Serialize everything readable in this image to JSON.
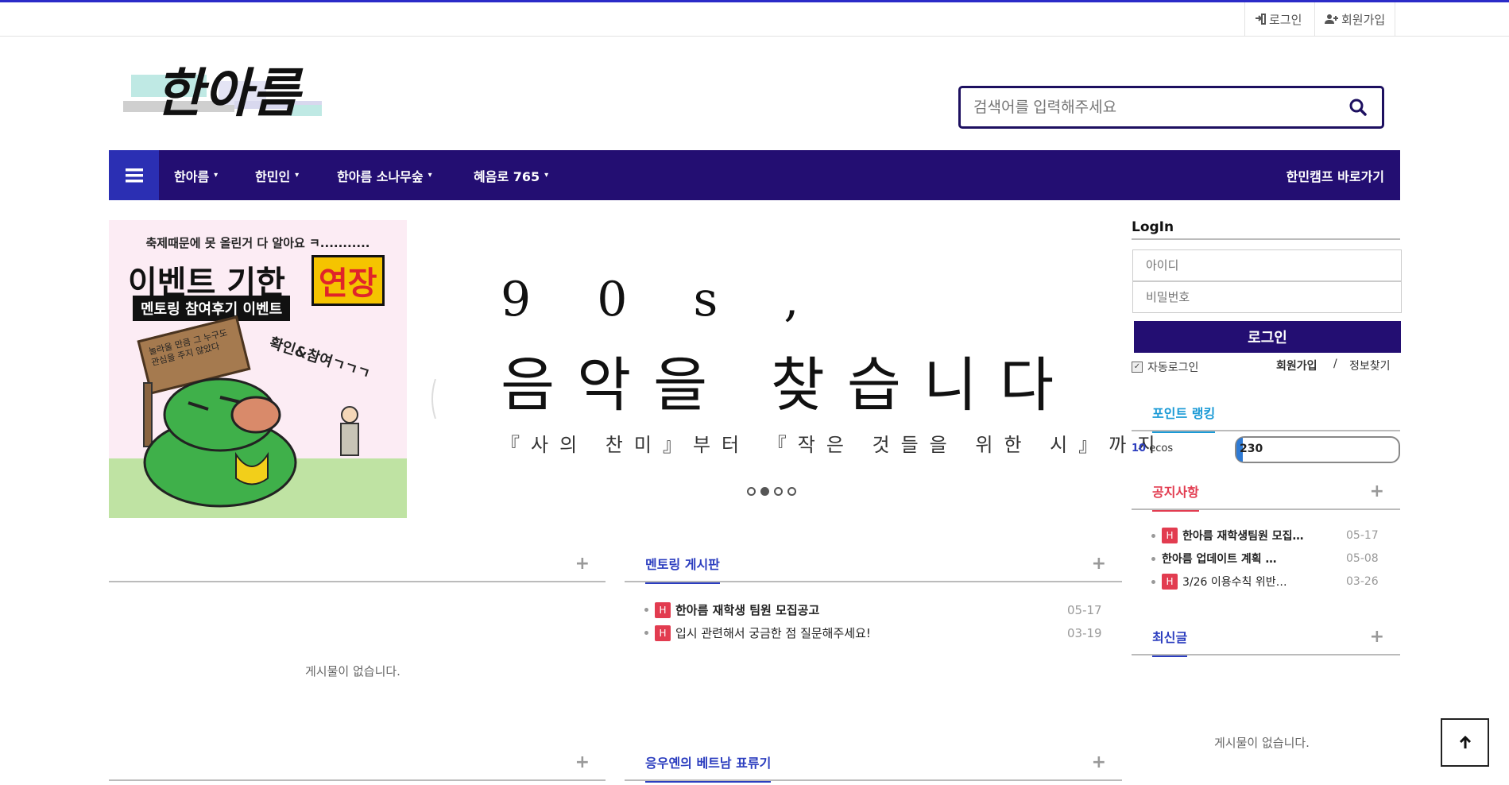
{
  "topbar": {
    "login": "로그인",
    "signup": "회원가입"
  },
  "search": {
    "placeholder": "검색어를 입력해주세요"
  },
  "logo": {
    "text": "한아름"
  },
  "nav": {
    "items": [
      {
        "label": "한아름"
      },
      {
        "label": "한민인"
      },
      {
        "label": "한아름 소나무숲"
      },
      {
        "label": "혜음로 765"
      }
    ],
    "right_link": "한민캠프 바로가기"
  },
  "event_banner": {
    "line1": "축제때문에 못 올린거 다 알아요 ㅋ...........",
    "line2a": "이벤트 기한",
    "line2b": "연장",
    "line3": "멘토링 참여후기 이벤트",
    "sign": "놀라울 만큼 그 누구도 관심을 주지 않았다",
    "side": "확인&참여ㄱㄱㄱ"
  },
  "slider": {
    "line1": "9 0 s ,",
    "line2": "음악을 찾습니다",
    "line3": "『사의 찬미』부터 『작은 것들을 위한 시』까지",
    "dots": 4,
    "active_dot": 1
  },
  "boards": {
    "left_top": {
      "title": "",
      "plus": "+",
      "empty": "게시물이 없습니다."
    },
    "mentoring": {
      "title": "멘토링 게시판",
      "plus": "+",
      "items": [
        {
          "badge": "H",
          "text": "한아름 재학생 팀원 모집공고",
          "date": "05-17",
          "bold": true
        },
        {
          "badge": "H",
          "text": "입시 관련해서 궁금한 점 질문해주세요!",
          "date": "03-19",
          "bold": false
        }
      ]
    },
    "left_bottom": {
      "title": "",
      "plus": "+"
    },
    "vietnam": {
      "title": "응우옌의 베트남 표류기",
      "plus": "+"
    }
  },
  "login": {
    "title": "LogIn",
    "id_placeholder": "아이디",
    "pw_placeholder": "비밀번호",
    "button": "로그인",
    "auto_login": "자동로그인",
    "signup": "회원가입",
    "separator": "/",
    "find": "정보찾기"
  },
  "points": {
    "tab": "포인트 랭킹",
    "rank": "10",
    "unit": "ecos",
    "value": "230",
    "value_fraction": 0.04
  },
  "notice": {
    "title": "공지사항",
    "plus": "+",
    "items": [
      {
        "badge": "H",
        "text": "한아름 재학생팀원 모집…",
        "date": "05-17"
      },
      {
        "badge": "",
        "text": "한아름 업데이트 계획 …",
        "date": "05-08"
      },
      {
        "badge": "H",
        "text": "3/26 이용수칙 위반…",
        "date": "03-26"
      }
    ]
  },
  "latest": {
    "title": "최신글",
    "plus": "+",
    "empty": "게시물이 없습니다."
  },
  "colors": {
    "brand": "#230e72",
    "accent": "#2b3dbf",
    "notice": "#e23c50",
    "points_tab": "#1a9ad6"
  }
}
